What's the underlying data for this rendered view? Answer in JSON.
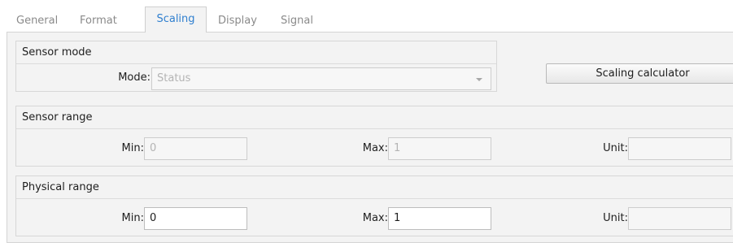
{
  "tabs": [
    {
      "label": "General"
    },
    {
      "label": "Format"
    },
    {
      "label": "Scaling"
    },
    {
      "label": "Display"
    },
    {
      "label": "Signal"
    }
  ],
  "active_tab": "Scaling",
  "colors": {
    "accent": "#2f7fcf",
    "panel": "#f3f3f3"
  },
  "sensor_mode": {
    "title": "Sensor mode",
    "mode_label": "Mode:",
    "mode_value": "Status"
  },
  "scaling_calculator_label": "Scaling calculator",
  "sensor_range": {
    "title": "Sensor range",
    "min_label": "Min:",
    "min_value": "0",
    "max_label": "Max:",
    "max_value": "1",
    "unit_label": "Unit:",
    "unit_value": ""
  },
  "physical_range": {
    "title": "Physical range",
    "min_label": "Min:",
    "min_value": "0",
    "max_label": "Max:",
    "max_value": "1",
    "unit_label": "Unit:",
    "unit_value": ""
  }
}
